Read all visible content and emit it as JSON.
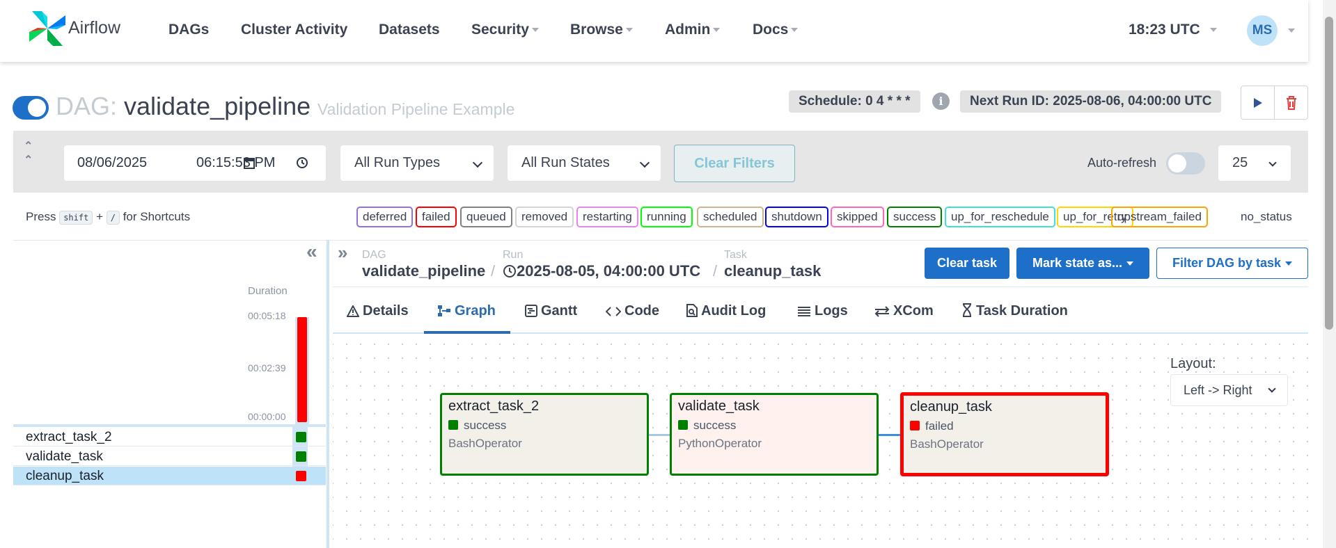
{
  "brand": {
    "name": "Airflow"
  },
  "nav": {
    "items": [
      {
        "label": "DAGs"
      },
      {
        "label": "Cluster Activity"
      },
      {
        "label": "Datasets"
      },
      {
        "label": "Security"
      },
      {
        "label": "Browse"
      },
      {
        "label": "Admin"
      },
      {
        "label": "Docs"
      }
    ],
    "time": "18:23 UTC",
    "user_initials": "MS"
  },
  "dag": {
    "prefix": "DAG:",
    "name": "validate_pipeline",
    "description": "Validation Pipeline Example",
    "schedule": "Schedule: 0 4 * * *",
    "next_run": "Next Run ID: 2025-08-06, 04:00:00 UTC",
    "info_icon": "i"
  },
  "filters": {
    "date": "08/06/2025",
    "time": "06:15:53 PM",
    "run_types": "All Run Types",
    "run_states": "All Run States",
    "clear_label": "Clear Filters",
    "autorefresh_label": "Auto-refresh",
    "page_size": "25"
  },
  "shortcuts": {
    "press": "Press",
    "key1": "shift",
    "plus": "+",
    "key2": "/",
    "suffix": "for Shortcuts"
  },
  "legend": [
    {
      "label": "deferred",
      "color": "#9370db"
    },
    {
      "label": "failed",
      "color": "#ff0000"
    },
    {
      "label": "queued",
      "color": "#808080"
    },
    {
      "label": "removed",
      "color": "#d3d3d3"
    },
    {
      "label": "restarting",
      "color": "#ee82ee"
    },
    {
      "label": "running",
      "color": "#00ff00"
    },
    {
      "label": "scheduled",
      "color": "#d2b48c"
    },
    {
      "label": "shutdown",
      "color": "#0000ff"
    },
    {
      "label": "skipped",
      "color": "#ff69b4"
    },
    {
      "label": "success",
      "color": "#008000"
    },
    {
      "label": "up_for_reschedule",
      "color": "#40e0d0"
    },
    {
      "label": "up_for_retry",
      "color": "#ffd700"
    },
    {
      "label": "upstream_failed",
      "color": "#ffa500"
    }
  ],
  "legend_no_status": "no_status",
  "grid": {
    "duration_label": "Duration",
    "ticks": [
      "00:05:18",
      "00:02:39",
      "00:00:00"
    ],
    "run_duration_fraction": 1.0,
    "tasks": [
      {
        "name": "extract_task_2",
        "state_color": "#008000"
      },
      {
        "name": "validate_task",
        "state_color": "#008000"
      },
      {
        "name": "cleanup_task",
        "state_color": "#ff0000"
      }
    ]
  },
  "breadcrumb": {
    "dag_label": "DAG",
    "dag_value": "validate_pipeline",
    "run_label": "Run",
    "run_value": "2025-08-05, 04:00:00 UTC",
    "task_label": "Task",
    "task_value": "cleanup_task",
    "sep": "/"
  },
  "actions": {
    "clear_task": "Clear task",
    "mark_state": "Mark state as...",
    "filter_dag": "Filter DAG by task"
  },
  "tabs": [
    {
      "label": "Details",
      "icon": "warning-triangle-icon"
    },
    {
      "label": "Graph",
      "icon": "graph-icon"
    },
    {
      "label": "Gantt",
      "icon": "gantt-icon"
    },
    {
      "label": "Code",
      "icon": "code-icon"
    },
    {
      "label": "Audit Log",
      "icon": "audit-log-icon"
    },
    {
      "label": "Logs",
      "icon": "list-icon"
    },
    {
      "label": "XCom",
      "icon": "swap-arrows-icon"
    },
    {
      "label": "Task Duration",
      "icon": "hourglass-icon"
    }
  ],
  "graph": {
    "layout_label": "Layout:",
    "layout_value": "Left -> Right",
    "nodes": [
      {
        "name": "extract_task_2",
        "state": "success",
        "operator": "BashOperator",
        "border": "#008000",
        "fill": "#f3f0ea",
        "state_color": "#008000"
      },
      {
        "name": "validate_task",
        "state": "success",
        "operator": "PythonOperator",
        "border": "#008000",
        "fill": "#fff1ed",
        "state_color": "#008000"
      },
      {
        "name": "cleanup_task",
        "state": "failed",
        "operator": "BashOperator",
        "border": "#ff0000",
        "fill": "#f3f0ea",
        "state_color": "#ff0000"
      }
    ]
  },
  "colors": {
    "accent": "#1e6fc8",
    "selected_row": "#bee3f8"
  }
}
